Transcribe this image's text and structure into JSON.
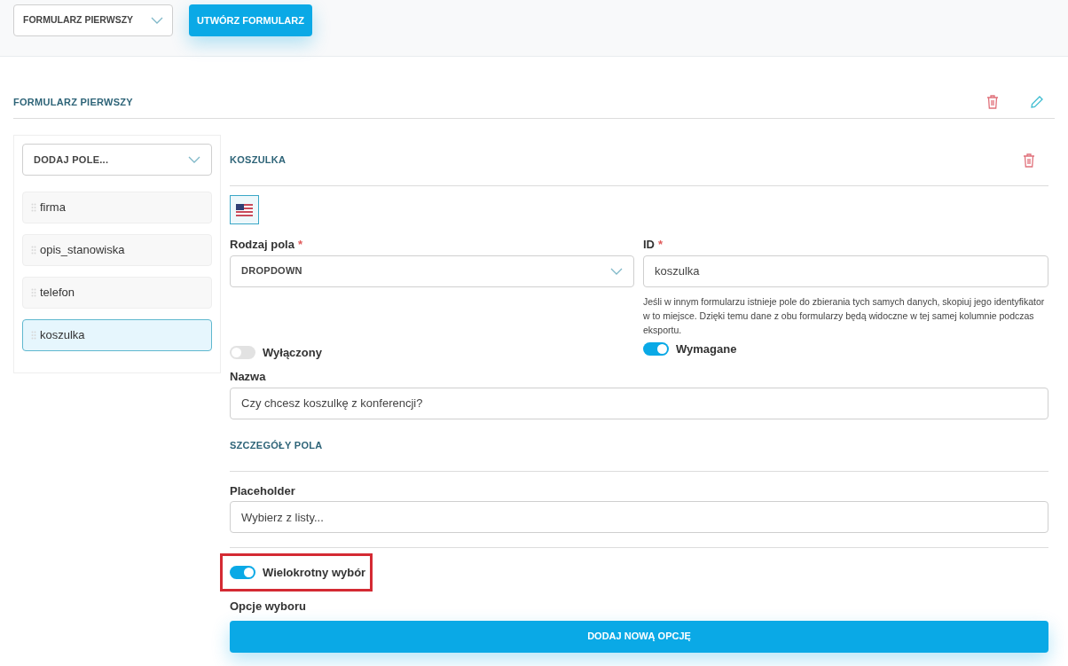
{
  "top_bar": {
    "form_select": {
      "value": "FORMULARZ PIERWSZY"
    },
    "create_button": "UTWÓRZ FORMULARZ"
  },
  "form": {
    "title": "FORMULARZ PIERWSZY"
  },
  "sidebar": {
    "add_field_select": {
      "value": "DODAJ POLE..."
    },
    "items": [
      {
        "label": "firma",
        "selected": false
      },
      {
        "label": "opis_stanowiska",
        "selected": false
      },
      {
        "label": "telefon",
        "selected": false
      },
      {
        "label": "koszulka",
        "selected": true
      }
    ]
  },
  "field": {
    "title": "KOSZULKA",
    "language": {
      "selected": true
    },
    "type": {
      "label": "Rodzaj pola",
      "required_mark": "*",
      "value": "DROPDOWN"
    },
    "id": {
      "label": "ID",
      "required_mark": "*",
      "value": "koszulka",
      "help": "Jeśli w innym formularzu istnieje pole do zbierania tych samych danych, skopiuj jego identyfikator w to miejsce. Dzięki temu dane z obu formularzy będą widoczne w tej samej kolumnie podczas eksportu."
    },
    "disabled_toggle": {
      "label": "Wyłączony",
      "on": false
    },
    "required_toggle": {
      "label": "Wymagane",
      "on": true
    },
    "name": {
      "label": "Nazwa",
      "value": "Czy chcesz koszulkę z konferencji?"
    },
    "details_title": "SZCZEGÓŁY POLA",
    "placeholder": {
      "label": "Placeholder",
      "value": "Wybierz z listy..."
    },
    "multi_toggle": {
      "label": "Wielokrotny wybór",
      "on": true,
      "highlighted": true
    },
    "options": {
      "label": "Opcje wyboru",
      "add_button": "DODAJ NOWĄ OPCJĘ"
    }
  }
}
